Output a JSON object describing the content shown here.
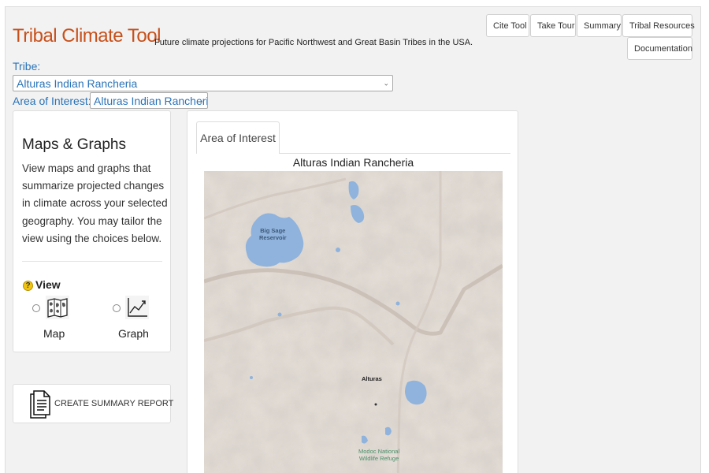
{
  "header": {
    "title": "Tribal Climate Tool",
    "subtitle": "Future climate projections for Pacific Northwest and Great Basin Tribes in the USA."
  },
  "nav": {
    "cite": "Cite Tool",
    "tour": "Take Tour",
    "summary": "Summary",
    "resources": "Tribal Resources",
    "documentation": "Documentation"
  },
  "filters": {
    "tribe_label": "Tribe:",
    "tribe_value": "Alturas Indian Rancheria",
    "aoi_label": "Area of Interest:",
    "aoi_value": "Alturas Indian Rancheria"
  },
  "sidebar": {
    "title": "Maps & Graphs",
    "description": "View maps and graphs that summarize projected changes in climate across your selected geography. You may tailor the view using the choices below.",
    "view_label": "View",
    "help_glyph": "?",
    "options": {
      "map": "Map",
      "graph": "Graph"
    },
    "report_label": "CREATE SUMMARY REPORT"
  },
  "main": {
    "tab_label": "Area of Interest",
    "map_title": "Alturas Indian Rancheria",
    "map_labels": {
      "reservoir_line1": "Big Sage",
      "reservoir_line2": "Reservoir",
      "town": "Alturas",
      "refuge_line1": "Modoc National",
      "refuge_line2": "Wildlife Refuge"
    }
  },
  "colors": {
    "brand": "#c8501a",
    "link": "#2a73b8",
    "water": "#8fb3dc",
    "terrain": "#e6dfd8"
  },
  "icons": [
    "chevron-down-icon",
    "help-icon",
    "map-icon",
    "graph-icon",
    "report-icon"
  ]
}
